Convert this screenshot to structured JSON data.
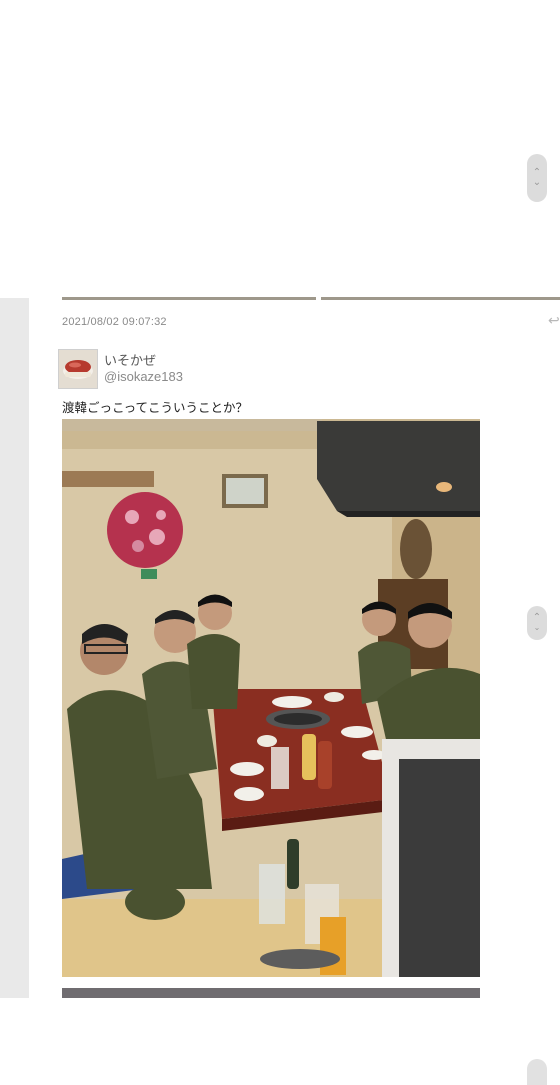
{
  "post": {
    "timestamp": "2021/08/02 09:07:32",
    "user": {
      "display_name": "いそかぜ",
      "handle": "@isokaze183"
    },
    "text": "渡韓ごっこってこういうことか？"
  },
  "icons": {
    "scroll_up": "chevron-up-icon",
    "scroll_down": "chevron-down-icon",
    "share": "share-arrow-icon"
  },
  "colors": {
    "panel": "#e9e9e9",
    "uniform": "#4a5230",
    "table": "#8a2e21"
  }
}
